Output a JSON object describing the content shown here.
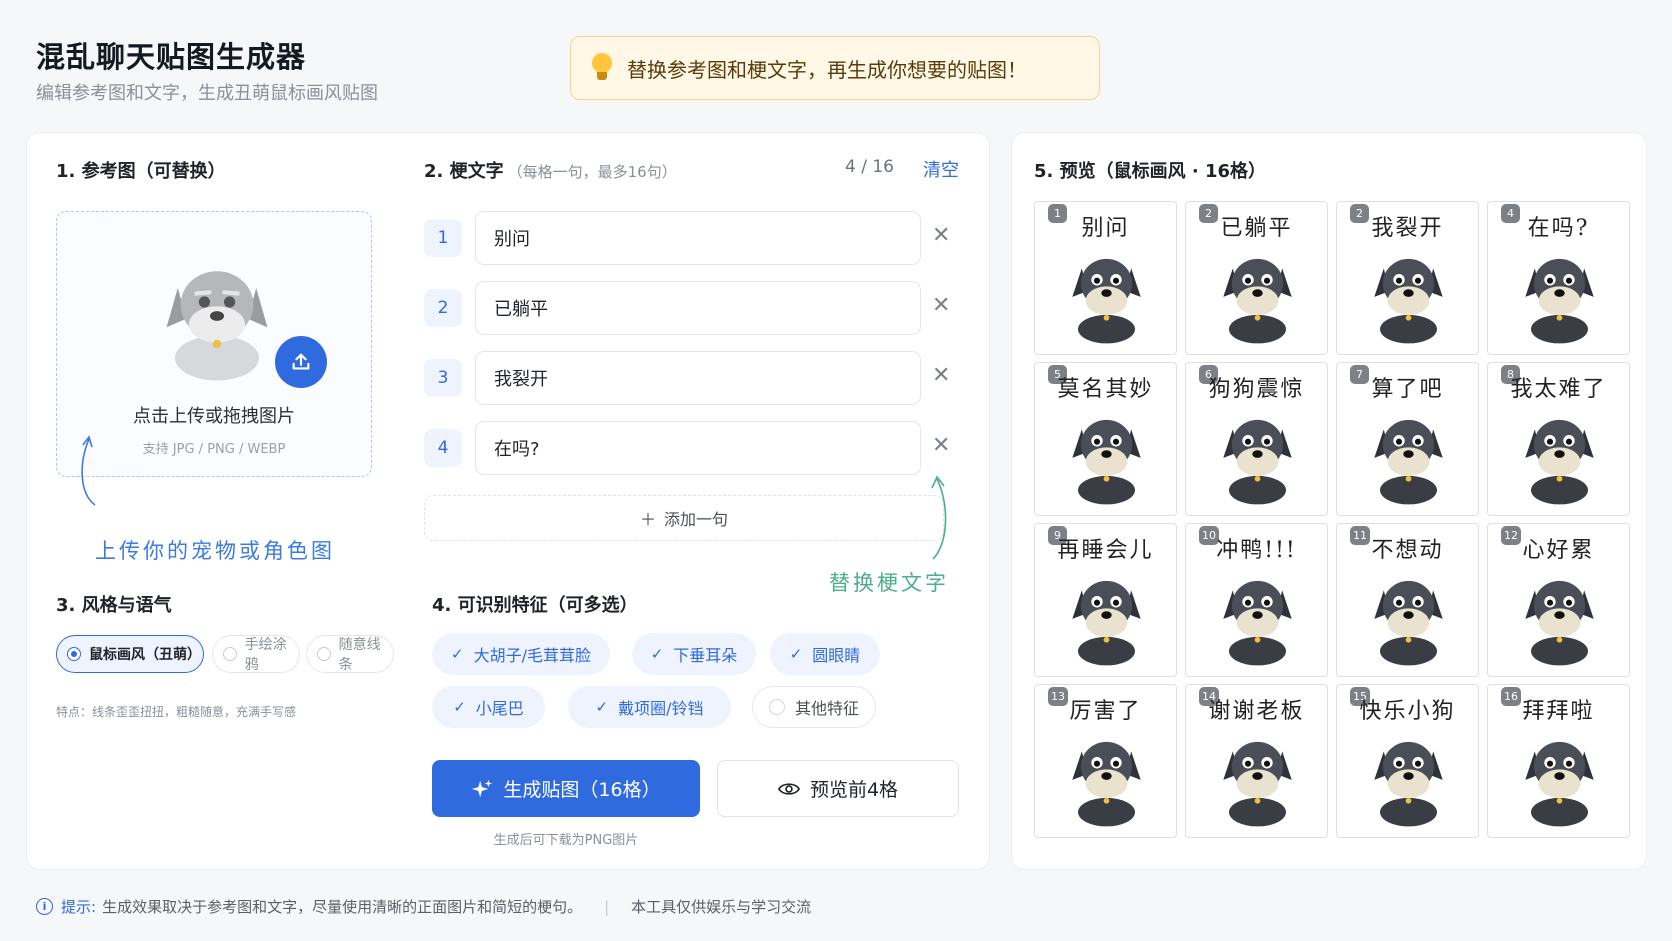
{
  "header": {
    "title": "混乱聊天贴图生成器",
    "subtitle": "编辑参考图和文字，生成丑萌鼠标画风贴图",
    "tip": "替换参考图和梗文字，再生成你想要的贴图！"
  },
  "reference": {
    "title": "1. 参考图（可替换）",
    "upload_text": "点击上传或拖拽图片",
    "formats": "支持 JPG / PNG / WEBP",
    "annotation": "上传你的宠物或角色图"
  },
  "memes": {
    "title": "2. 梗文字",
    "hint": "（每格一句，最多16句）",
    "count": "4 / 16",
    "clear_label": "清空",
    "lines": [
      {
        "num": "1",
        "text": "别问"
      },
      {
        "num": "2",
        "text": "已躺平"
      },
      {
        "num": "3",
        "text": "我裂开"
      },
      {
        "num": "4",
        "text": "在吗?"
      }
    ],
    "add_label": "添加一句",
    "annotation": "替换梗文字"
  },
  "style": {
    "title": "3. 风格与语气",
    "options": [
      {
        "label": "鼠标画风（丑萌）",
        "selected": true
      },
      {
        "label": "手绘涂鸦",
        "selected": false
      },
      {
        "label": "随意线条",
        "selected": false
      }
    ],
    "note": "特点：线条歪歪扭扭，粗糙随意，充满手写感"
  },
  "features": {
    "title": "4. 可识别特征（可多选）",
    "items": [
      {
        "label": "大胡子/毛茸茸脸",
        "checked": true
      },
      {
        "label": "下垂耳朵",
        "checked": true
      },
      {
        "label": "圆眼睛",
        "checked": true
      },
      {
        "label": "小尾巴",
        "checked": true
      },
      {
        "label": "戴项圈/铃铛",
        "checked": true
      },
      {
        "label": "其他特征",
        "checked": false
      }
    ]
  },
  "actions": {
    "generate_label": "生成贴图（16格）",
    "preview_label": "预览前4格",
    "generate_note": "生成后可下载为PNG图片"
  },
  "preview": {
    "title": "5. 预览（鼠标画风 · 16格）",
    "tiles": [
      {
        "idx": "1",
        "text": "别问"
      },
      {
        "idx": "2",
        "text": "已躺平"
      },
      {
        "idx": "2",
        "text": "我裂开"
      },
      {
        "idx": "4",
        "text": "在吗?"
      },
      {
        "idx": "5",
        "text": "莫名其妙"
      },
      {
        "idx": "6",
        "text": "狗狗震惊"
      },
      {
        "idx": "7",
        "text": "算了吧"
      },
      {
        "idx": "8",
        "text": "我太难了"
      },
      {
        "idx": "9",
        "text": "再睡会儿"
      },
      {
        "idx": "10",
        "text": "冲鸭!!!"
      },
      {
        "idx": "11",
        "text": "不想动"
      },
      {
        "idx": "12",
        "text": "心好累"
      },
      {
        "idx": "13",
        "text": "厉害了"
      },
      {
        "idx": "14",
        "text": "谢谢老板"
      },
      {
        "idx": "15",
        "text": "快乐小狗"
      },
      {
        "idx": "16",
        "text": "拜拜啦"
      }
    ]
  },
  "footer": {
    "tip_label": "提示:",
    "tip_text": "生成效果取决于参考图和文字，尽量使用清晰的正面图片和简短的梗句。",
    "disclaimer": "本工具仅供娱乐与学习交流"
  },
  "colors": {
    "accent": "#2f6bde",
    "tip_background": "#fff8e6",
    "annotation_blue": "#3b7be0",
    "annotation_green": "#4cae8a"
  }
}
